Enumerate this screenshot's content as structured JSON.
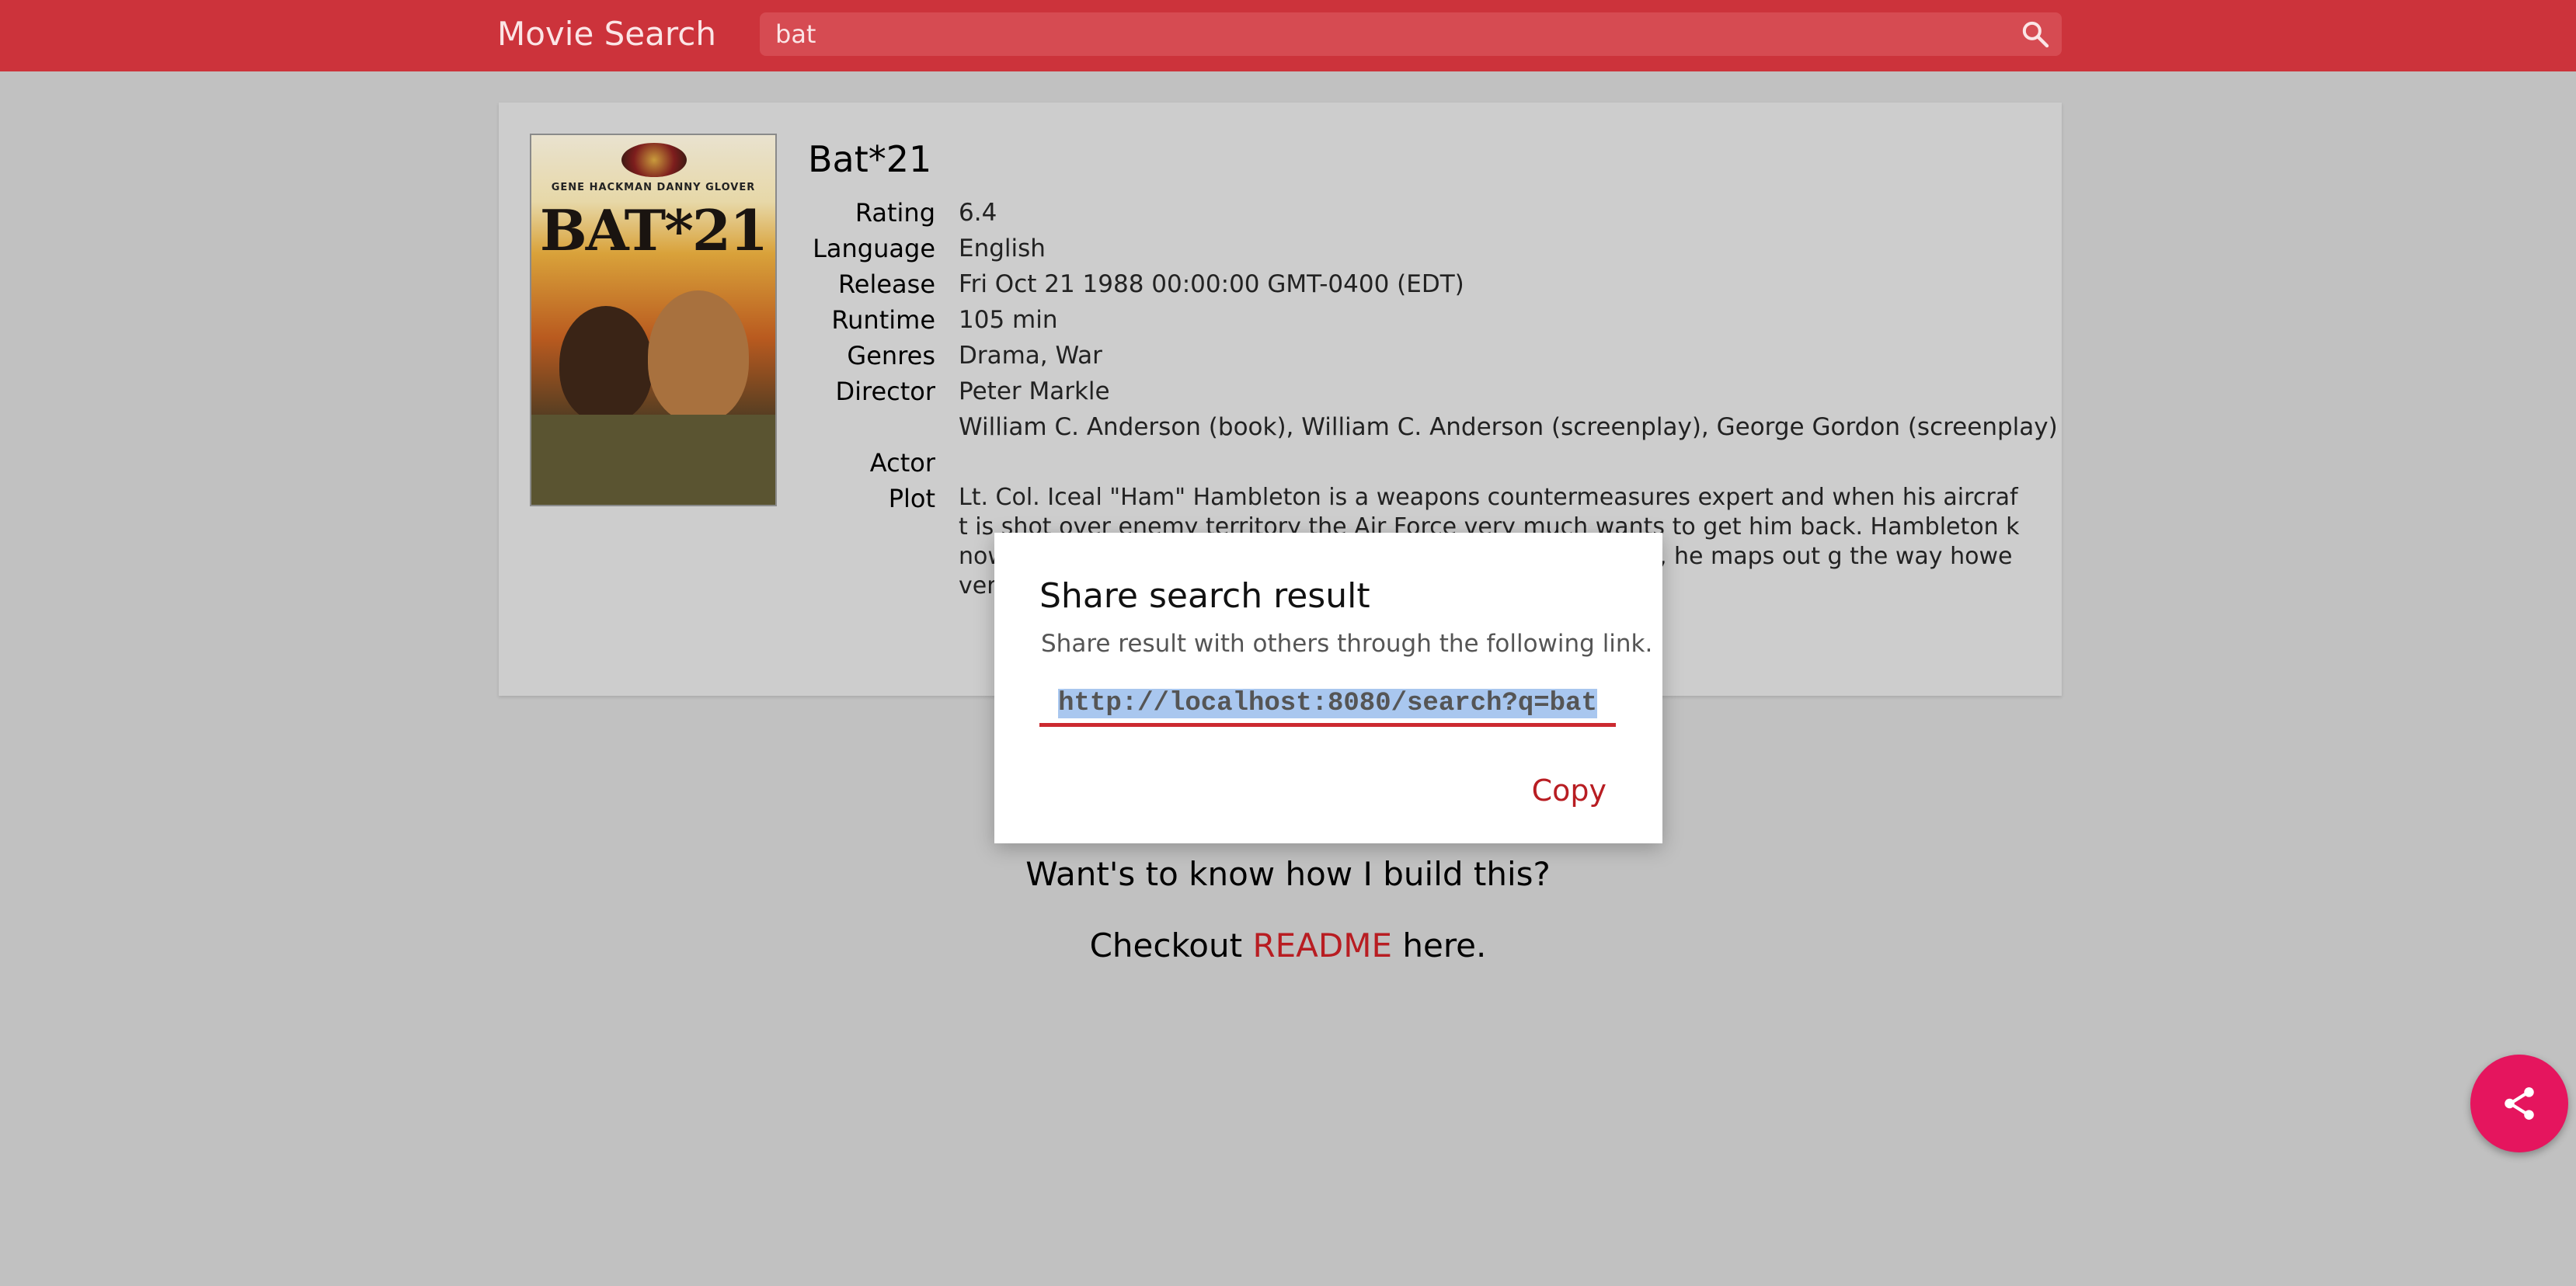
{
  "header": {
    "app_title": "Movie Search",
    "search_value": "bat",
    "search_icon": "search-icon"
  },
  "movie": {
    "title": "Bat*21",
    "poster": {
      "names": "GENE HACKMAN     DANNY GLOVER",
      "title_art": "BAT*21"
    },
    "fields": {
      "rating_label": "Rating",
      "rating": "6.4",
      "language_label": "Language",
      "language": "English",
      "release_label": "Release",
      "release": "Fri Oct 21 1988 00:00:00 GMT-0400 (EDT)",
      "runtime_label": "Runtime",
      "runtime": "105 min",
      "genres_label": "Genres",
      "genres": "Drama, War",
      "director_label": "Director",
      "director": "Peter Markle",
      "writer": "William C. Anderson (book), William C. Anderson (screenplay), George Gordon (screenplay)",
      "actor_label": "Actor",
      "plot_label": "Plot",
      "plot": "Lt. Col. Iceal \"Ham\" Hambleton is a weapons countermeasures expert and when his aircraft is shot over enemy territory the Air Force very much wants to get him back. Hambleton knows the shortage of helicopters causes Bartholomew Clark, he maps out g the way however, he has to face"
    }
  },
  "footer": {
    "line1": "Want's to know how I build this?",
    "line2_prefix": "Checkout ",
    "readme_link": "README",
    "line2_suffix": " here."
  },
  "dialog": {
    "title": "Share search result",
    "subtitle": "Share result with others through the following link.",
    "link": "http://localhost:8080/search?q=bat",
    "copy_label": "Copy"
  },
  "fab": {
    "icon": "share-icon",
    "color": "#e5155e"
  },
  "colors": {
    "header_bg": "#cc333b",
    "accent": "#b81d22"
  }
}
